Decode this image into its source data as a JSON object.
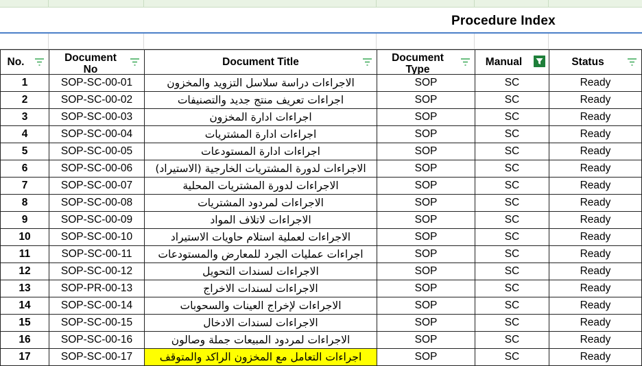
{
  "page_title": "Procedure Index",
  "columns": [
    {
      "key": "no",
      "label": "No.",
      "filter": "inactive"
    },
    {
      "key": "doc_no",
      "label": "Document No",
      "filter": "inactive"
    },
    {
      "key": "doc_title",
      "label": "Document Title",
      "filter": "inactive"
    },
    {
      "key": "doc_type",
      "label": "Document Type",
      "filter": "inactive"
    },
    {
      "key": "manual",
      "label": "Manual",
      "filter": "active"
    },
    {
      "key": "status",
      "label": "Status",
      "filter": "inactive"
    }
  ],
  "rows": [
    {
      "no": "1",
      "doc_no": "SOP-SC-00-01",
      "doc_title": "الاجراءات دراسة سلاسل التزويد والمخزون",
      "doc_type": "SOP",
      "manual": "SC",
      "status": "Ready"
    },
    {
      "no": "2",
      "doc_no": "SOP-SC-00-02",
      "doc_title": "اجراءات تعريف منتج جديد والتصنيفات",
      "doc_type": "SOP",
      "manual": "SC",
      "status": "Ready"
    },
    {
      "no": "3",
      "doc_no": "SOP-SC-00-03",
      "doc_title": "اجراءات ادارة المخزون",
      "doc_type": "SOP",
      "manual": "SC",
      "status": "Ready"
    },
    {
      "no": "4",
      "doc_no": "SOP-SC-00-04",
      "doc_title": "اجراءات ادارة المشتريات",
      "doc_type": "SOP",
      "manual": "SC",
      "status": "Ready"
    },
    {
      "no": "5",
      "doc_no": "SOP-SC-00-05",
      "doc_title": "اجراءات ادارة المستودعات",
      "doc_type": "SOP",
      "manual": "SC",
      "status": "Ready"
    },
    {
      "no": "6",
      "doc_no": "SOP-SC-00-06",
      "doc_title": "الاجراءات لدورة المشتريات الخارجية (الاستيراد)",
      "doc_type": "SOP",
      "manual": "SC",
      "status": "Ready"
    },
    {
      "no": "7",
      "doc_no": "SOP-SC-00-07",
      "doc_title": "الاجراءات لدورة المشتريات المحلية",
      "doc_type": "SOP",
      "manual": "SC",
      "status": "Ready"
    },
    {
      "no": "8",
      "doc_no": "SOP-SC-00-08",
      "doc_title": "الاجراءات  لمردود المشتريات",
      "doc_type": "SOP",
      "manual": "SC",
      "status": "Ready"
    },
    {
      "no": "9",
      "doc_no": "SOP-SC-00-09",
      "doc_title": "الاجراءات لاتلاف المواد",
      "doc_type": "SOP",
      "manual": "SC",
      "status": "Ready"
    },
    {
      "no": "10",
      "doc_no": "SOP-SC-00-10",
      "doc_title": "الاجراءات لعملية استلام حاويات الاستيراد",
      "doc_type": "SOP",
      "manual": "SC",
      "status": "Ready"
    },
    {
      "no": "11",
      "doc_no": "SOP-SC-00-11",
      "doc_title": "اجراءات عمليات الجرد للمعارض والمستودعات",
      "doc_type": "SOP",
      "manual": "SC",
      "status": "Ready"
    },
    {
      "no": "12",
      "doc_no": "SOP-SC-00-12",
      "doc_title": "الاجراءات لسندات التحويل",
      "doc_type": "SOP",
      "manual": "SC",
      "status": "Ready"
    },
    {
      "no": "13",
      "doc_no": "SOP-PR-00-13",
      "doc_title": "الاجراءات لسندات الاخراج",
      "doc_type": "SOP",
      "manual": "SC",
      "status": "Ready"
    },
    {
      "no": "14",
      "doc_no": "SOP-SC-00-14",
      "doc_title": "الاجراءات لإخراج العينات والسحوبات",
      "doc_type": "SOP",
      "manual": "SC",
      "status": "Ready"
    },
    {
      "no": "15",
      "doc_no": "SOP-SC-00-15",
      "doc_title": "الاجراءات لسندات الادخال",
      "doc_type": "SOP",
      "manual": "SC",
      "status": "Ready"
    },
    {
      "no": "16",
      "doc_no": "SOP-SC-00-16",
      "doc_title": "الاجراءات لمردود المبيعات جملة وصالون",
      "doc_type": "SOP",
      "manual": "SC",
      "status": "Ready"
    },
    {
      "no": "17",
      "doc_no": "SOP-SC-00-17",
      "doc_title": "اجراءات التعامل مع المخزون الراكد والمتوقف",
      "doc_type": "SOP",
      "manual": "SC",
      "status": "Ready",
      "highlight": true
    }
  ],
  "colors": {
    "highlight": "#ffff00",
    "filter_icon": "#3aa857",
    "filter_active_bg": "#1e7f3a",
    "title_border": "#4a7fc8",
    "header_strip": "#e9f3e4"
  },
  "icons": {
    "filter": "filter-icon",
    "filter_active": "filter-active-icon"
  }
}
